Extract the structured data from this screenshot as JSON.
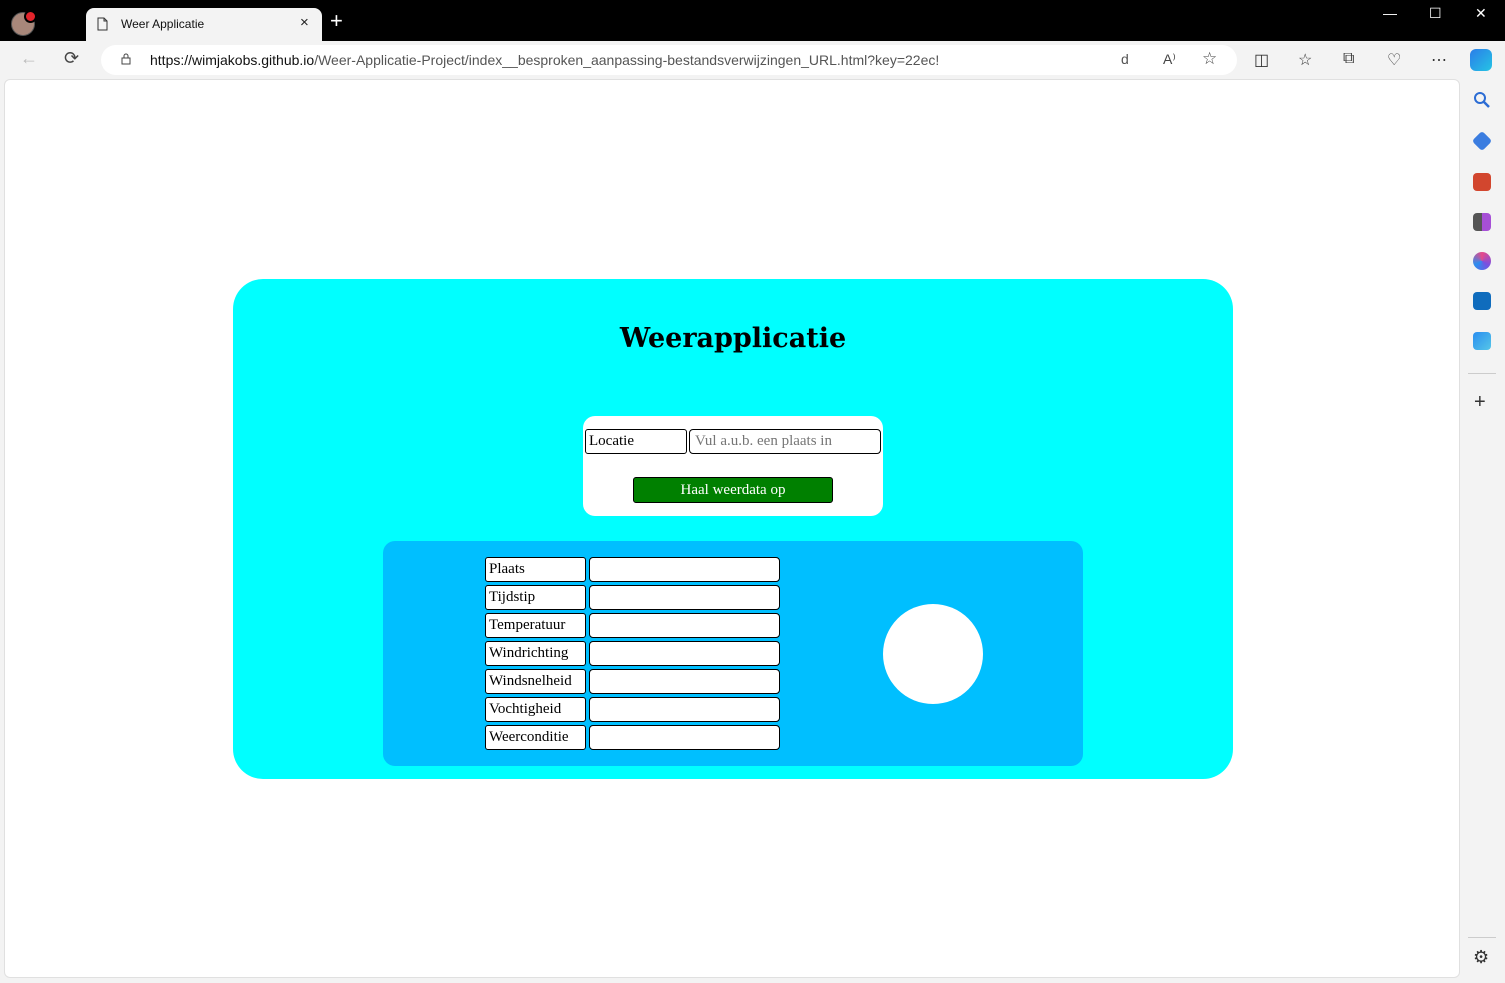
{
  "browser": {
    "tab_title": "Weer Applicatie",
    "tab_close": "×",
    "new_tab": "+",
    "url_domain": "https://wimjakobs.github.io",
    "url_path": "/Weer-Applicatie-Project/index__besproken_aanpassing-bestandsverwijzingen_URL.html?key=22ec!",
    "url_suffix": "d",
    "window_controls": {
      "minimize": "—",
      "maximize": "☐",
      "close": "✕"
    },
    "nav": {
      "back": "←",
      "refresh": "⟳"
    },
    "toolbar_icons": {
      "read_aloud": "A⁾",
      "favorite": "☆",
      "split": "◫",
      "favorites": "☆",
      "collections": "⧉",
      "heartbeat": "♡",
      "more": "⋯"
    }
  },
  "sidebar": {
    "icons": [
      "search-icon",
      "tag-icon",
      "briefcase-icon",
      "chess-icon",
      "office-icon",
      "outlook-icon",
      "telegram-icon",
      "add-icon",
      "settings-icon"
    ],
    "add": "+",
    "settings": "⚙"
  },
  "app": {
    "title": "Weerapplicatie",
    "form": {
      "location_label": "Locatie",
      "location_placeholder": "Vul a.u.b. een plaats in",
      "submit_label": "Haal weerdata op"
    },
    "results": {
      "rows": [
        {
          "label": "Plaats",
          "value": ""
        },
        {
          "label": "Tijdstip",
          "value": ""
        },
        {
          "label": "Temperatuur",
          "value": ""
        },
        {
          "label": "Windrichting",
          "value": ""
        },
        {
          "label": "Windsnelheid",
          "value": ""
        },
        {
          "label": "Vochtigheid",
          "value": ""
        },
        {
          "label": "Weerconditie",
          "value": ""
        }
      ]
    }
  },
  "colors": {
    "app_background": "#00ffff",
    "results_background": "#00bfff",
    "button_background": "#008000"
  }
}
